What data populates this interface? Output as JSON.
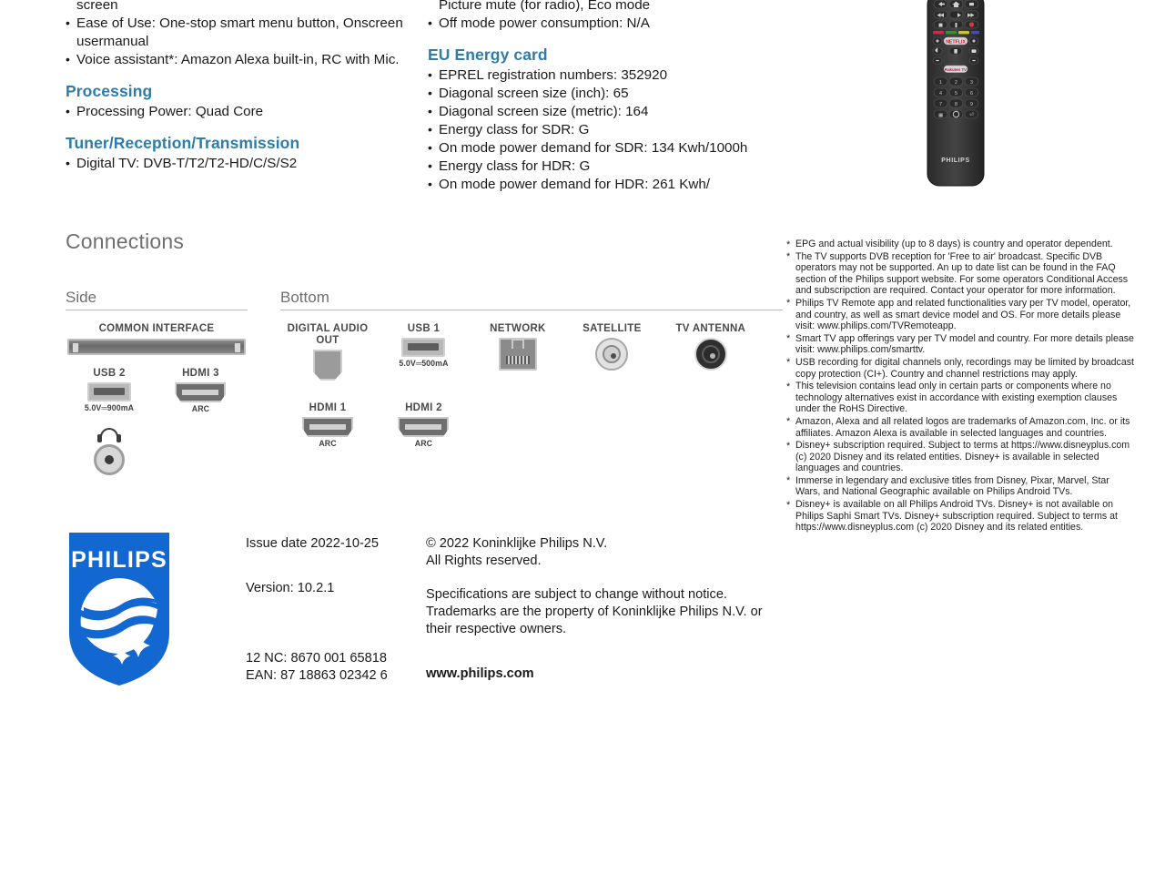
{
  "left_column": {
    "continued_item": "screen",
    "features": [
      {
        "type": "bullet",
        "text": "Ease of Use: One-stop smart menu button, Onscreen usermanual"
      },
      {
        "type": "bullet",
        "text": "Voice assistant*: Amazon Alexa built-in, RC with Mic."
      }
    ],
    "sections": [
      {
        "heading": "Processing",
        "items": [
          "Processing Power: Quad Core"
        ]
      },
      {
        "heading": "Tuner/Reception/Transmission",
        "items": [
          "Digital TV: DVB-T/T2/T2-HD/C/S/S2"
        ]
      }
    ]
  },
  "mid_column": {
    "continued_item": "Picture mute (for radio), Eco mode",
    "features": [
      {
        "type": "bullet",
        "text": "Off mode power consumption: N/A"
      }
    ],
    "sections": [
      {
        "heading": "EU Energy card",
        "items": [
          "EPREL registration numbers: 352920",
          "Diagonal screen size (inch): 65",
          "Diagonal screen size (metric): 164",
          "Energy class for SDR: G",
          "On mode power demand for SDR: 134 Kwh/1000h",
          "Energy class for HDR: G",
          "On mode power demand for HDR: 261 Kwh/"
        ]
      }
    ]
  },
  "remote": {
    "brand": "PHILIPS",
    "app_buttons": [
      "NETFLIX",
      "rakuten tv"
    ]
  },
  "connections": {
    "title": "Connections",
    "side": {
      "label": "Side",
      "ports": [
        {
          "name": "COMMON INTERFACE",
          "sub": "",
          "icon": "ci-slot-icon"
        },
        {
          "name": "USB 2",
          "sub": "5.0V═900mA",
          "icon": "usb-port-icon"
        },
        {
          "name": "HDMI 3",
          "sub": "ARC",
          "icon": "hdmi-port-icon"
        },
        {
          "name": "",
          "sub": "",
          "icon": "headphone-jack-icon"
        }
      ]
    },
    "bottom": {
      "label": "Bottom",
      "row1": [
        {
          "name": "DIGITAL AUDIO OUT",
          "sub": "",
          "icon": "optical-audio-icon"
        },
        {
          "name": "USB 1",
          "sub": "5.0V═500mA",
          "icon": "usb-port-icon"
        },
        {
          "name": "NETWORK",
          "sub": "",
          "icon": "ethernet-rj45-icon"
        },
        {
          "name": "SATELLITE",
          "sub": "",
          "icon": "satellite-coax-icon"
        },
        {
          "name": "TV ANTENNA",
          "sub": "",
          "icon": "antenna-coax-icon"
        }
      ],
      "row2": [
        {
          "name": "HDMI 1",
          "sub": "ARC",
          "icon": "hdmi-port-icon"
        },
        {
          "name": "HDMI 2",
          "sub": "ARC",
          "icon": "hdmi-port-icon"
        }
      ]
    }
  },
  "footnotes": [
    "EPG and actual visibility (up to 8 days) is country and operator dependent.",
    "The TV supports DVB reception for 'Free to air' broadcast. Specific DVB operators may not be supported. An up to date list can be found in the FAQ section of the Philips support website. For some operators Conditional Access and subscripction are required. Contact your operator for more information.",
    "Philips TV Remote app and related functionalities vary per TV model, operator, and country, as well as smart device model and OS. For more details please visit: www.philips.com/TVRemoteapp.",
    "Smart TV app offerings vary per TV model and country. For more details please visit: www.philips.com/smarttv.",
    "USB recording for digital channels only, recordings may be limited by broadcast copy protection (CI+). Country and channel restrictions may apply.",
    "This television contains lead only in certain parts or components where no technology alternatives exist in accordance with existing exemption clauses under the RoHS Directive.",
    "Amazon, Alexa and all related logos are trademarks of Amazon.com, Inc. or its affiliates. Amazon Alexa is available in selected languages and countries.",
    "Disney+ subscription required. Subject to terms at https://www.disneyplus.com (c) 2020 Disney and its related entities. Disney+ is available in selected languages and countries.",
    "Immerse in legendary and exclusive titles from Disney, Pixar, Marvel, Star Wars, and National Geographic available on Philips Android TVs.",
    "Disney+ is available on all Philips Android TVs. Disney+ is not available on Philips Saphi Smart TVs. Disney+ subscription required. Subject to terms at https://www.disneyplus.com (c) 2020 Disney and its related entities."
  ],
  "footer": {
    "brand": "PHILIPS",
    "issue_date": "Issue date 2022-10-25",
    "version": "Version: 10.2.1",
    "nc_code": "12 NC: 8670 001 65818",
    "ean_code": "EAN: 87 18863 02342 6",
    "copyright_line1": "© 2022 Koninklijke Philips N.V.",
    "copyright_line2": "All Rights reserved.",
    "disclaimer": "Specifications are subject to change without notice. Trademarks are the property of Koninklijke Philips N.V. or their respective owners.",
    "website": "www.philips.com"
  },
  "colors": {
    "heading_blue": "#2f7ca8",
    "philips_blue": "#1267d1",
    "gray_heading": "#6f6f6f",
    "body_text": "#1a1a1a"
  }
}
